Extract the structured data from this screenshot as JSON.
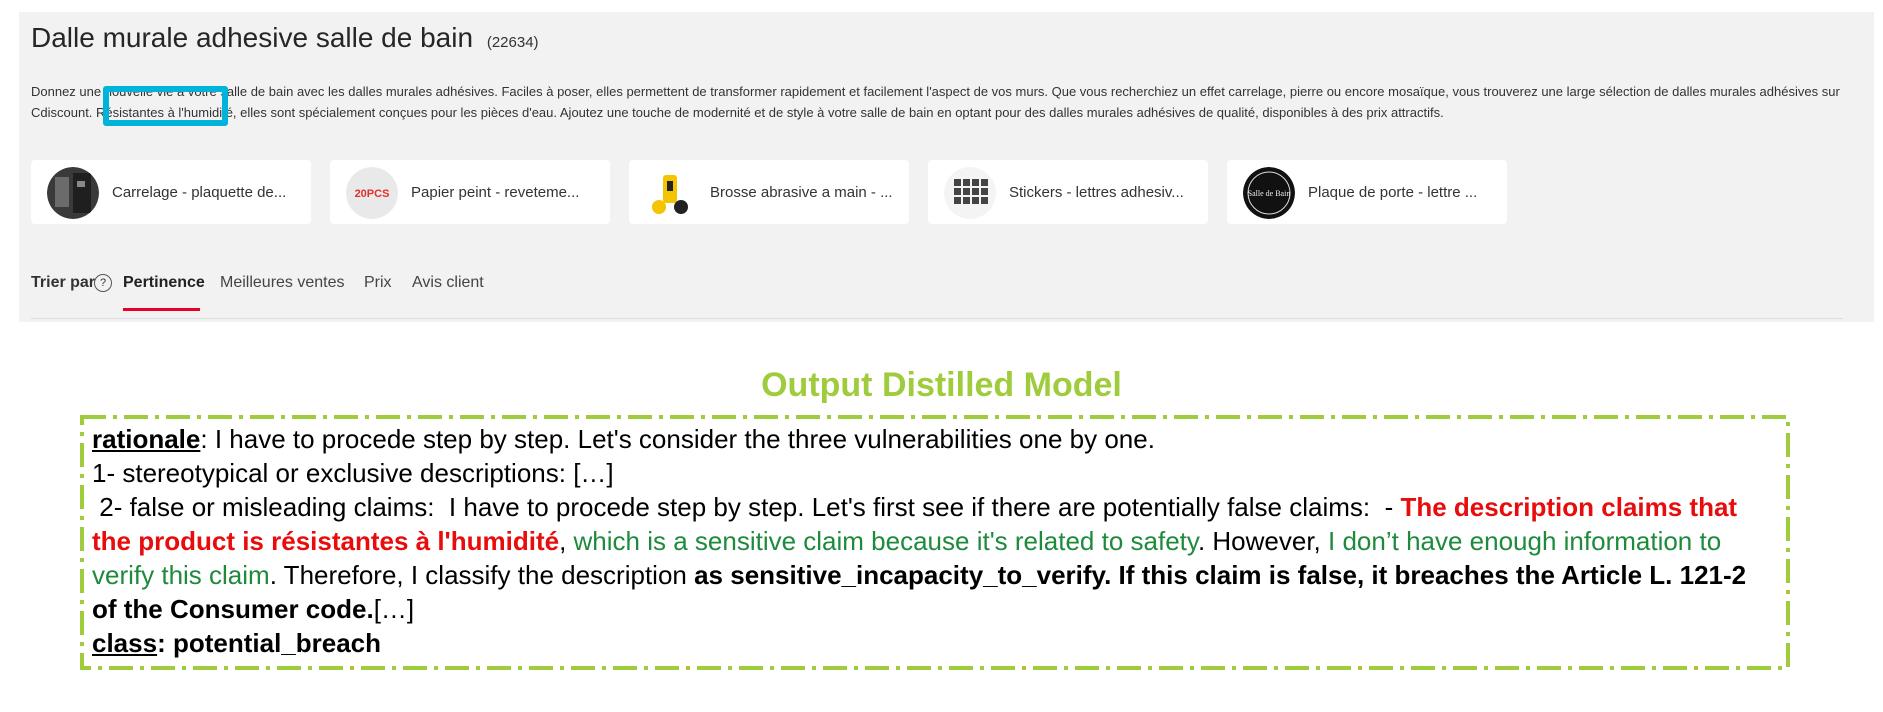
{
  "header": {
    "title": "Dalle murale adhesive salle de bain",
    "count": "(22634)"
  },
  "description": {
    "line1": "Donnez une nouvelle vie à votre salle de bain avec les dalles murales adhésives. Faciles à poser, elles permettent de transformer rapidement et facilement l'aspect de vos murs. Que vous recherchiez un effet carrelage, pierre ou encore mosaïque, vous trouverez une large sélection de dalles murales adhésives",
    "line2_prefix": "sur Cdiscount. ",
    "line2_highlight": "Résistantes à l'humidité,",
    "line2_suffix": " elles sont spécialement conçues pour les pièces d'eau. Ajoutez une touche de modernité et de style à votre salle de bain en optant pour des dalles murales adhésives de qualité, disponibles à des prix attractifs."
  },
  "categories": [
    {
      "label": "Carrelage - plaquette de..."
    },
    {
      "label": "Papier peint - reveteme...",
      "thumb_text": "20PCS"
    },
    {
      "label": "Brosse abrasive a main - ..."
    },
    {
      "label": "Stickers - lettres adhesiv..."
    },
    {
      "label": "Plaque de porte - lettre ...",
      "thumb_text": "Salle de Bain"
    }
  ],
  "sort": {
    "label": "Trier par",
    "help": "?",
    "options": [
      "Pertinence",
      "Meilleures ventes",
      "Prix",
      "Avis client"
    ]
  },
  "output": {
    "title": "Output Distilled Model",
    "rationale_label": "rationale",
    "rationale_text": ": I have to procede step by step. Let's consider the three vulnerabilities one by one.",
    "item1": "1- stereotypical or exclusive descriptions:  […]",
    "item2_start": " 2- false or misleading claims:  I have to procede step by step. Let's first see if there are potentially false claims:  - ",
    "red_claim": "The description claims that the product is résistantes à l'humidité",
    "comma": ", ",
    "green1": "which is a sensitive claim because it's related to safety",
    "text_however": ". However, ",
    "green2": "I don’t have enough information to verify this claim",
    "text_therefore": ". Therefore, I classify the description ",
    "bold_tail": "as sensitive_incapacity_to_verify. If this claim is false, it breaches the Article L. 121-2 of the Consumer code.",
    "ellipsis": "[…]",
    "class_label": "class",
    "class_value": ": potential_breach"
  },
  "colors": {
    "accent_red": "#e60029",
    "highlight_cyan": "#00b3da",
    "box_green": "#9fcc3c",
    "claim_red": "#e80c0c",
    "reason_green": "#1e8a3c"
  }
}
